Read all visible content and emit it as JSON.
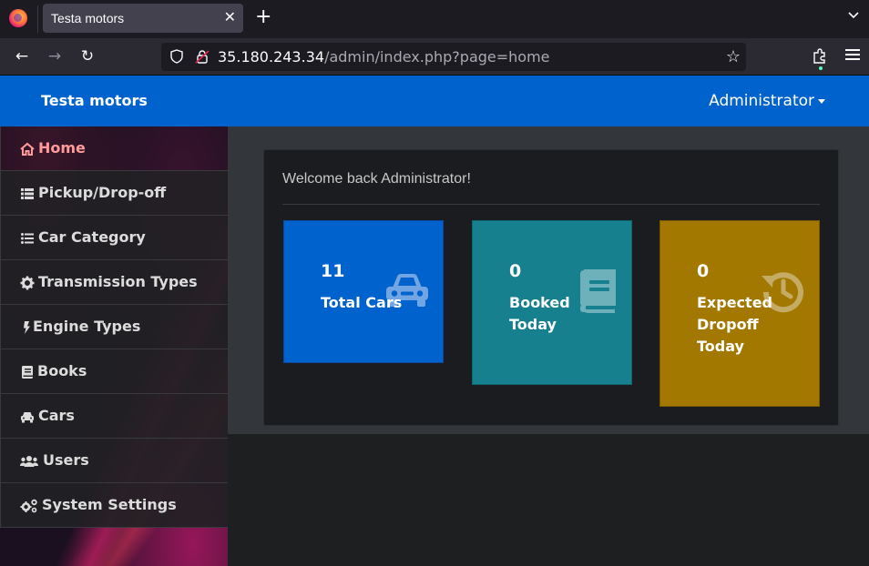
{
  "browser": {
    "tab_title": "Testa motors",
    "url_host": "35.180.243.34",
    "url_path": "/admin/index.php?page=home"
  },
  "app": {
    "brand": "Testa motors",
    "user": "Administrator"
  },
  "sidebar": {
    "items": [
      {
        "label": "Home",
        "icon": "home-icon",
        "active": true
      },
      {
        "label": "Pickup/Drop-off",
        "icon": "list-icon"
      },
      {
        "label": "Car Category",
        "icon": "list-ul-icon"
      },
      {
        "label": "Transmission Types",
        "icon": "gear-icon"
      },
      {
        "label": "Engine Types",
        "icon": "bolt-icon"
      },
      {
        "label": "Books",
        "icon": "book-icon"
      },
      {
        "label": "Cars",
        "icon": "car-icon"
      },
      {
        "label": "Users",
        "icon": "users-icon"
      },
      {
        "label": "System Settings",
        "icon": "gears-icon"
      }
    ]
  },
  "dashboard": {
    "welcome": "Welcome back Administrator!",
    "stats": [
      {
        "value": "11",
        "label": "Total Cars",
        "icon": "car-icon",
        "color": "#0062cc"
      },
      {
        "value": "0",
        "label": "Booked Today",
        "icon": "book-icon",
        "color": "#17808e"
      },
      {
        "value": "0",
        "label": "Expected Dropoff Today",
        "icon": "history-icon",
        "color": "#a37800"
      }
    ]
  }
}
